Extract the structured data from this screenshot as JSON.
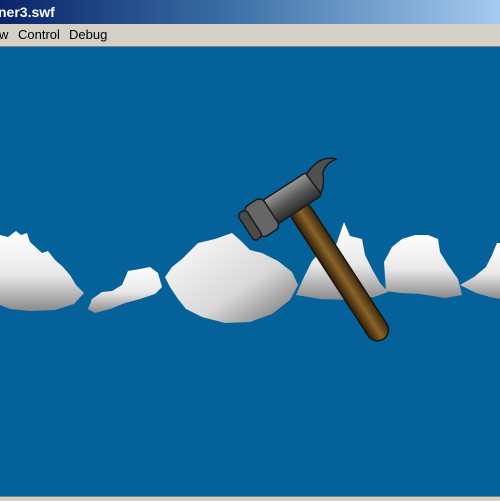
{
  "window": {
    "title": "ner3.swf"
  },
  "menu": {
    "items": [
      "w",
      "Control",
      "Debug"
    ]
  },
  "stage": {
    "background": "#05619a"
  },
  "colors": {
    "title_start": "#0a246a",
    "title_end": "#a6caf0",
    "chrome": "#d4d0c8"
  },
  "icons": {
    "hammer": "hammer-icon"
  }
}
